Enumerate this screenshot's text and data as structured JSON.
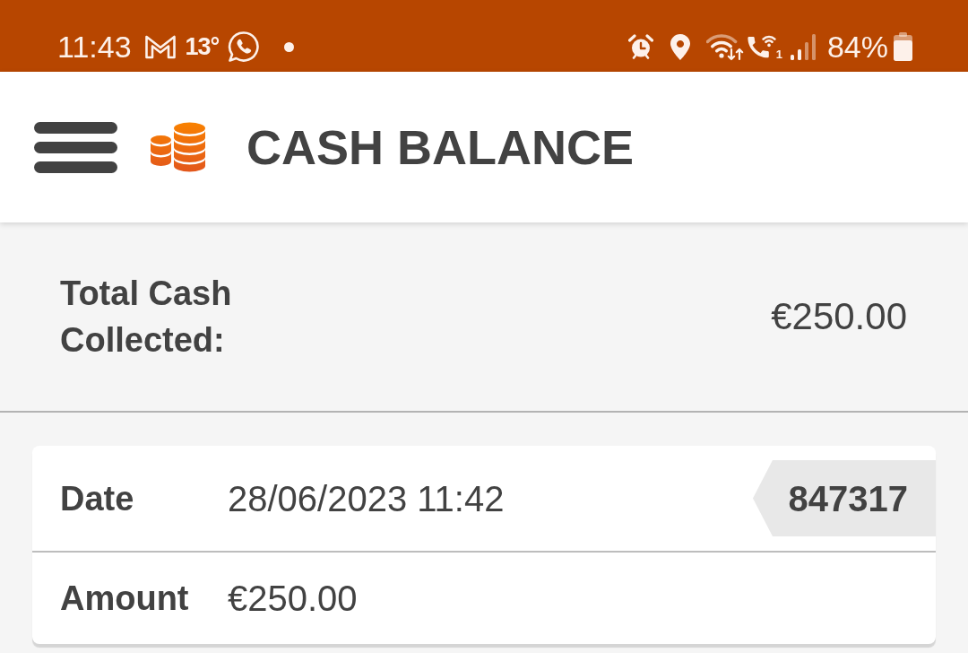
{
  "status_bar": {
    "time": "11:43",
    "temperature": "13°",
    "wifi_call_slot": "1",
    "battery": "84%"
  },
  "header": {
    "title": "CASH BALANCE"
  },
  "summary": {
    "label": "Total Cash Collected:",
    "value": "€250.00"
  },
  "transactions": [
    {
      "reference": "847317",
      "fields": [
        {
          "label": "Date",
          "value": "28/06/2023 11:42"
        },
        {
          "label": "Amount",
          "value": "€250.00"
        }
      ]
    }
  ]
}
